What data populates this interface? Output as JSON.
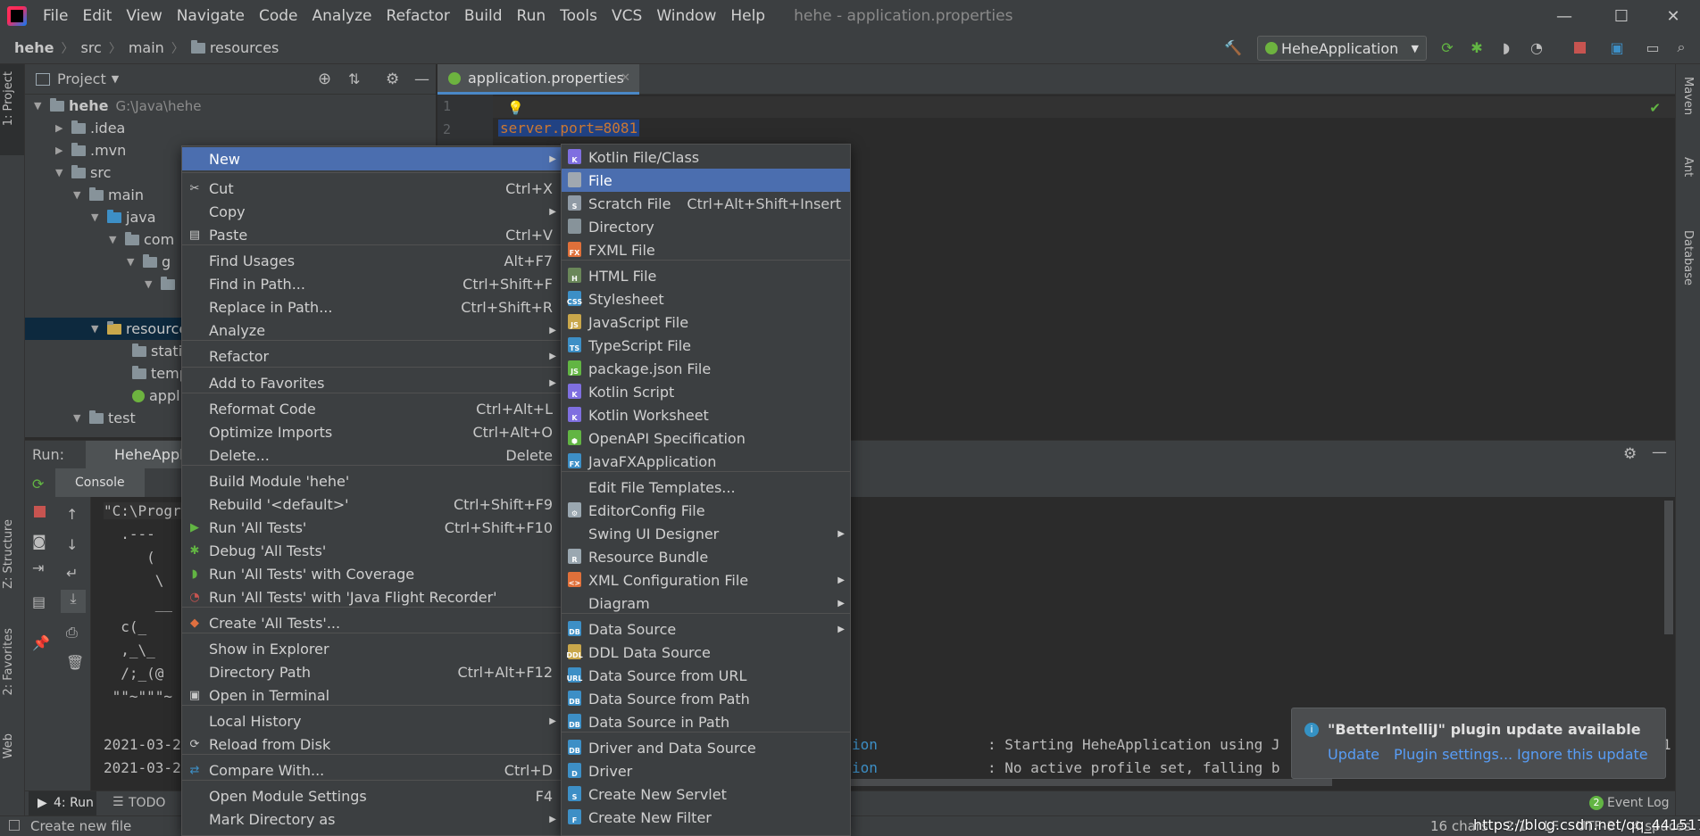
{
  "window": {
    "title": "hehe - application.properties",
    "menu": [
      "File",
      "Edit",
      "View",
      "Navigate",
      "Code",
      "Analyze",
      "Refactor",
      "Build",
      "Run",
      "Tools",
      "VCS",
      "Window",
      "Help"
    ],
    "controls": {
      "minimize": "—",
      "maximize": "☐",
      "close": "✕"
    }
  },
  "breadcrumb": [
    "hehe",
    "src",
    "main",
    "resources"
  ],
  "run_config": "HeheApplication",
  "project_panel": {
    "title": "Project",
    "tree": [
      {
        "label": "hehe",
        "path": "G:\\Java\\hehe"
      },
      {
        "label": ".idea"
      },
      {
        "label": ".mvn"
      },
      {
        "label": "src"
      },
      {
        "label": "main"
      },
      {
        "label": "java"
      },
      {
        "label": "com"
      },
      {
        "label": "g"
      },
      {
        "label": ""
      },
      {
        "label": "resources"
      },
      {
        "label": "stati"
      },
      {
        "label": "temp"
      },
      {
        "label": "appl"
      },
      {
        "label": "test"
      }
    ]
  },
  "left_tabs": [
    "1: Project",
    "Z: Structure",
    "2: Favorites",
    "Web"
  ],
  "right_tabs": [
    "Maven",
    "Ant",
    "Database"
  ],
  "editor": {
    "tab_label": "application.properties",
    "lines": [
      "1",
      "2"
    ],
    "code_line2": "server.port=8081"
  },
  "run_panel": {
    "label": "Run:",
    "tab": "HeheApplic",
    "console_tab": "Console",
    "console_lines": [
      "\"C:\\Progr",
      "  .---",
      "     (",
      "      \\",
      "      __",
      "  c(_",
      "  ,_\\_",
      "  /;_(@",
      " \"\"~\"\"\"~",
      "2021-03-2",
      "2021-03-2"
    ],
    "log_right_1a": "ion",
    "log_right_1b": ": Starting HeheApplication using J",
    "log_right_1c": "1",
    "log_right_2a": "ion",
    "log_right_2b": ": No active profile set, falling b"
  },
  "bottom_tabs": {
    "run": "4: Run",
    "todo": "TODO",
    "event_log": "Event Log",
    "event_count": "2"
  },
  "status": {
    "left": "Create new file",
    "right": "16 chars    2:1    LF    UTF-8    4 spaces",
    "watermark": "https://blog.csdn.net/qq_44151781"
  },
  "context_menu": [
    {
      "label": "New",
      "submenu": true,
      "selected": true
    },
    {
      "label": "Cut",
      "shortcut": "Ctrl+X",
      "icon": "scissors-icon"
    },
    {
      "label": "Copy",
      "submenu": true
    },
    {
      "label": "Paste",
      "shortcut": "Ctrl+V",
      "icon": "clipboard-icon"
    },
    {
      "label": "Find Usages",
      "shortcut": "Alt+F7"
    },
    {
      "label": "Find in Path...",
      "shortcut": "Ctrl+Shift+F"
    },
    {
      "label": "Replace in Path...",
      "shortcut": "Ctrl+Shift+R"
    },
    {
      "label": "Analyze",
      "submenu": true
    },
    {
      "label": "Refactor",
      "submenu": true
    },
    {
      "label": "Add to Favorites",
      "submenu": true
    },
    {
      "label": "Reformat Code",
      "shortcut": "Ctrl+Alt+L"
    },
    {
      "label": "Optimize Imports",
      "shortcut": "Ctrl+Alt+O"
    },
    {
      "label": "Delete...",
      "shortcut": "Delete"
    },
    {
      "label": "Build Module 'hehe'"
    },
    {
      "label": "Rebuild '<default>'",
      "shortcut": "Ctrl+Shift+F9"
    },
    {
      "label": "Run 'All Tests'",
      "shortcut": "Ctrl+Shift+F10",
      "icon": "run-icon"
    },
    {
      "label": "Debug 'All Tests'",
      "icon": "debug-icon"
    },
    {
      "label": "Run 'All Tests' with Coverage",
      "icon": "coverage-icon"
    },
    {
      "label": "Run 'All Tests' with 'Java Flight Recorder'",
      "icon": "profiler-icon"
    },
    {
      "label": "Create 'All Tests'...",
      "icon": "create-test-icon"
    },
    {
      "label": "Show in Explorer"
    },
    {
      "label": "Directory Path",
      "shortcut": "Ctrl+Alt+F12"
    },
    {
      "label": "Open in Terminal",
      "icon": "terminal-icon"
    },
    {
      "label": "Local History",
      "submenu": true
    },
    {
      "label": "Reload from Disk",
      "icon": "reload-icon"
    },
    {
      "label": "Compare With...",
      "shortcut": "Ctrl+D",
      "icon": "compare-icon"
    },
    {
      "label": "Open Module Settings",
      "shortcut": "F4"
    },
    {
      "label": "Mark Directory as",
      "submenu": true
    }
  ],
  "new_submenu": [
    {
      "label": "Kotlin File/Class",
      "icon": "kotlin-file-icon"
    },
    {
      "label": "File",
      "icon": "file-icon",
      "selected": true
    },
    {
      "label": "Scratch File",
      "shortcut": "Ctrl+Alt+Shift+Insert",
      "icon": "scratch-file-icon"
    },
    {
      "label": "Directory",
      "icon": "folder-icon"
    },
    {
      "label": "FXML File",
      "icon": "fxml-file-icon"
    },
    {
      "label": "HTML File",
      "icon": "html-file-icon"
    },
    {
      "label": "Stylesheet",
      "icon": "css-file-icon"
    },
    {
      "label": "JavaScript File",
      "icon": "js-file-icon"
    },
    {
      "label": "TypeScript File",
      "icon": "ts-file-icon"
    },
    {
      "label": "package.json File",
      "icon": "nodejs-icon"
    },
    {
      "label": "Kotlin Script",
      "icon": "kotlin-script-icon"
    },
    {
      "label": "Kotlin Worksheet",
      "icon": "kotlin-worksheet-icon"
    },
    {
      "label": "OpenAPI Specification",
      "icon": "openapi-icon"
    },
    {
      "label": "JavaFXApplication",
      "icon": "javafx-icon"
    },
    {
      "label": "Edit File Templates..."
    },
    {
      "label": "EditorConfig File",
      "icon": "gear-icon"
    },
    {
      "label": "Swing UI Designer",
      "submenu": true
    },
    {
      "label": "Resource Bundle",
      "icon": "resource-bundle-icon"
    },
    {
      "label": "XML Configuration File",
      "submenu": true,
      "icon": "xml-file-icon"
    },
    {
      "label": "Diagram",
      "submenu": true
    },
    {
      "label": "Data Source",
      "submenu": true,
      "icon": "datasource-icon"
    },
    {
      "label": "DDL Data Source",
      "icon": "ddl-icon"
    },
    {
      "label": "Data Source from URL",
      "icon": "datasource-url-icon"
    },
    {
      "label": "Data Source from Path",
      "icon": "datasource-path-icon"
    },
    {
      "label": "Data Source in Path",
      "icon": "datasource-in-path-icon"
    },
    {
      "label": "Driver and Data Source",
      "icon": "driver-datasource-icon"
    },
    {
      "label": "Driver",
      "icon": "driver-icon"
    },
    {
      "label": "Create New Servlet",
      "icon": "servlet-icon"
    },
    {
      "label": "Create New Filter",
      "icon": "filter-icon"
    }
  ],
  "notification": {
    "title": "\"BetterIntelliJ\" plugin update available",
    "actions": [
      "Update",
      "Plugin settings...",
      "Ignore this update"
    ]
  },
  "colors": {
    "selection": "#4b6eaf",
    "panel": "#3c3f41",
    "editor": "#2b2b2b",
    "link": "#589df6"
  }
}
